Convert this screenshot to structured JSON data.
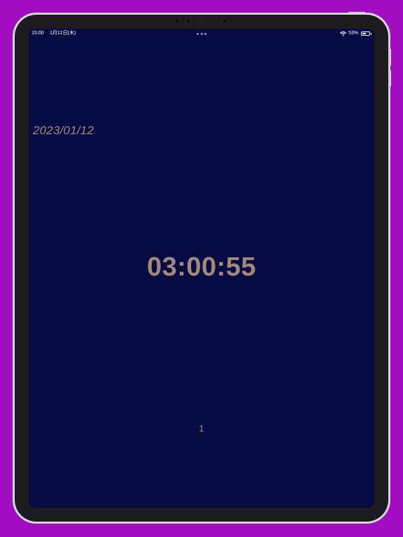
{
  "status_bar": {
    "time": "15:00",
    "date": "1月12日(木)",
    "battery_percent_text": "53%",
    "battery_level": 0.53,
    "wifi_icon": "wifi-icon"
  },
  "main": {
    "date": "2023/01/12",
    "clock": "03:00:55",
    "page_number": "1"
  },
  "colors": {
    "background": "#a20cc2",
    "screen": "#070b43",
    "text": "#a2877b"
  }
}
